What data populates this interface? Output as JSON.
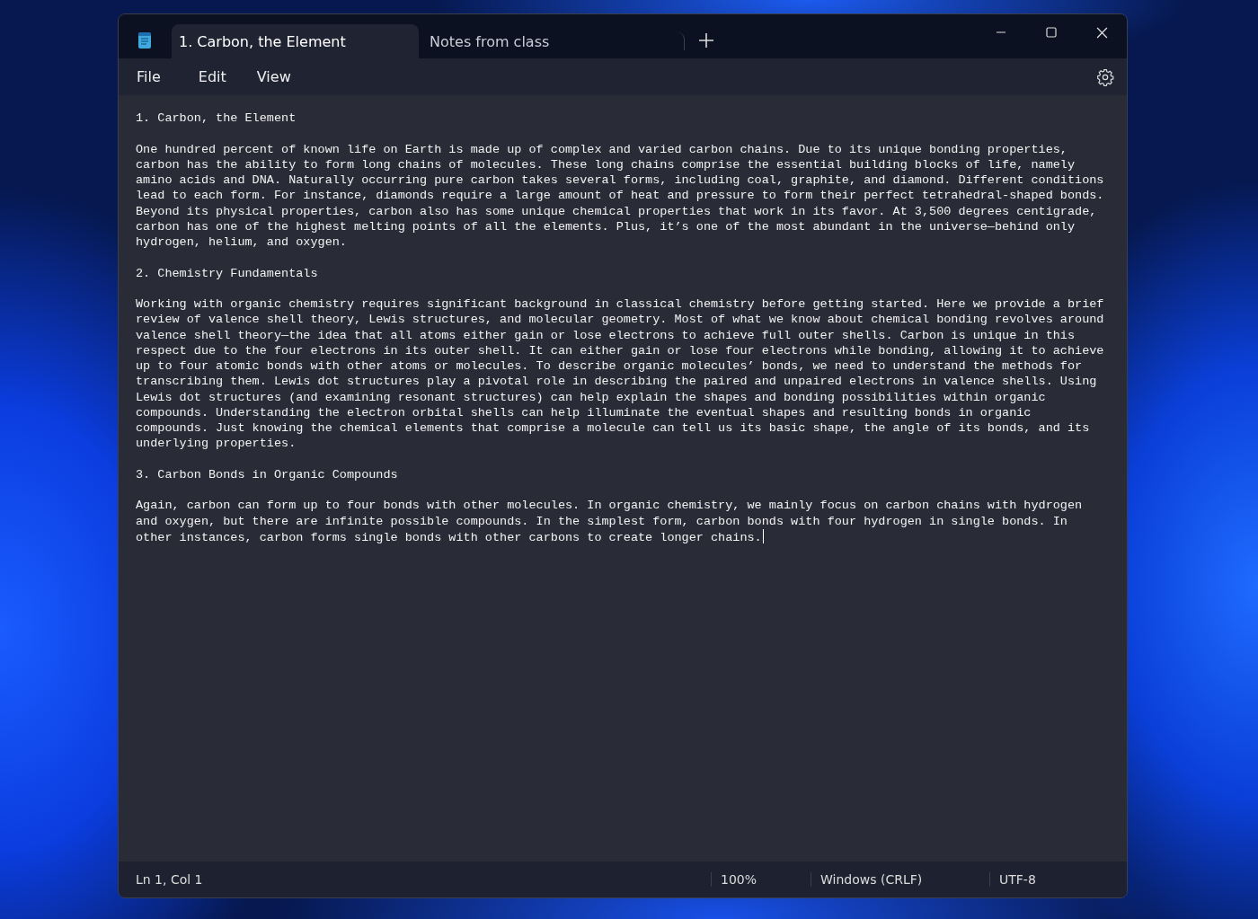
{
  "window": {
    "tabs": [
      {
        "title": "1. Carbon, the Element",
        "selected": true
      },
      {
        "title": "Notes from class",
        "selected": false
      }
    ]
  },
  "menu": [
    "File",
    "Edit",
    "View"
  ],
  "document": {
    "caret_at_end": true,
    "blocks": [
      {
        "text": "1. Carbon, the Element"
      },
      {
        "text": "One hundred percent of known life on Earth is made up of complex and varied carbon chains. Due to its unique bonding properties, carbon has the ability to form long chains of molecules. These long chains comprise the essential building blocks of life, namely amino acids and DNA. Naturally occurring pure carbon takes several forms, including coal, graphite, and diamond. Different conditions lead to each form. For instance, diamonds require a large amount of heat and pressure to form their perfect tetrahedral-shaped bonds. Beyond its physical properties, carbon also has some unique chemical properties that work in its favor. At 3,500 degrees centigrade, carbon has one of the highest melting points of all the elements. Plus, it’s one of the most abundant in the universe—behind only hydrogen, helium, and oxygen."
      },
      {
        "text": "2. Chemistry Fundamentals"
      },
      {
        "text": "Working with organic chemistry requires significant background in classical chemistry before getting started. Here we provide a brief review of valence shell theory, Lewis structures, and molecular geometry. Most of what we know about chemical bonding revolves around valence shell theory—the idea that all atoms either gain or lose electrons to achieve full outer shells. Carbon is unique in this respect due to the four electrons in its outer shell. It can either gain or lose four electrons while bonding, allowing it to achieve up to four atomic bonds with other atoms or molecules. To describe organic molecules’ bonds, we need to understand the methods for transcribing them. Lewis dot structures play a pivotal role in describing the paired and unpaired electrons in valence shells. Using Lewis dot structures (and examining resonant structures) can help explain the shapes and bonding possibilities within organic compounds. Understanding the electron orbital shells can help illuminate the eventual shapes and resulting bonds in organic compounds. Just knowing the chemical elements that comprise a molecule can tell us its basic shape, the angle of its bonds, and its underlying properties."
      },
      {
        "text": "3. Carbon Bonds in Organic Compounds"
      },
      {
        "text": "Again, carbon can form up to four bonds with other molecules. In organic chemistry, we mainly focus on carbon chains with hydrogen and oxygen, but there are infinite possible compounds. In the simplest form, carbon bonds with four hydrogen in single bonds. In other instances, carbon forms single bonds with other carbons to create longer chains."
      }
    ]
  },
  "status_bar": {
    "position": "Ln 1, Col 1",
    "zoom": "100%",
    "line_ending": "Windows (CRLF)",
    "encoding": "UTF-8"
  }
}
